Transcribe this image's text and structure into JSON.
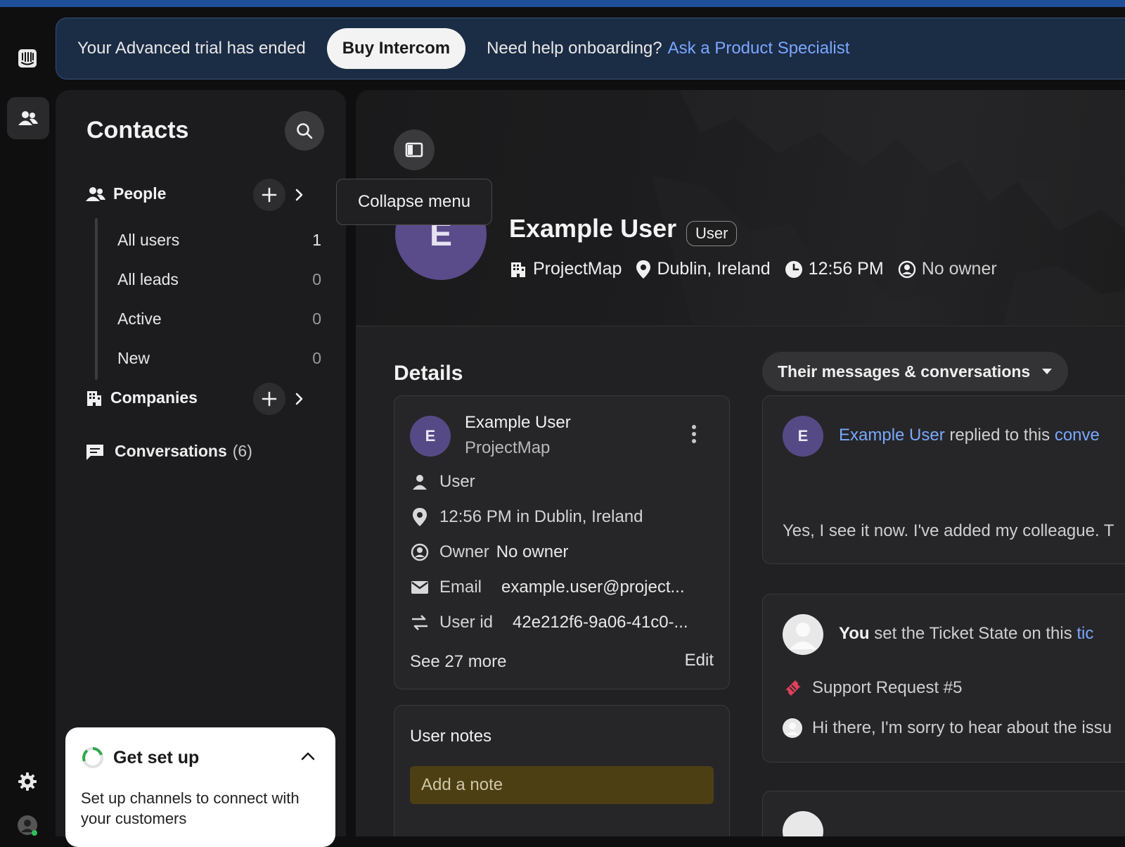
{
  "banner": {
    "trial_text": "Your Advanced trial has ended",
    "buy_label": "Buy Intercom",
    "help_text": "Need help onboarding?",
    "help_link": "Ask a Product Specialist"
  },
  "sidebar": {
    "title": "Contacts",
    "people_label": "People",
    "people_items": [
      {
        "label": "All users",
        "count": "1"
      },
      {
        "label": "All leads",
        "count": "0"
      },
      {
        "label": "Active",
        "count": "0"
      },
      {
        "label": "New",
        "count": "0"
      }
    ],
    "companies_label": "Companies",
    "conversations_label": "Conversations",
    "conversations_count": "(6)"
  },
  "setup": {
    "title": "Get set up",
    "description": "Set up channels to connect with your customers"
  },
  "tooltip": "Collapse menu",
  "profile": {
    "avatar_letter": "E",
    "name": "Example User",
    "badge": "User",
    "company": "ProjectMap",
    "location": "Dublin, Ireland",
    "time": "12:56 PM",
    "owner": "No owner"
  },
  "details": {
    "title": "Details",
    "card": {
      "avatar_letter": "E",
      "name": "Example User",
      "company": "ProjectMap",
      "type": "User",
      "local_time": "12:56 PM in Dublin, Ireland",
      "owner_label": "Owner",
      "owner_value": "No owner",
      "email_label": "Email",
      "email_value": "example.user@project...",
      "userid_label": "User id",
      "userid_value": "42e212f6-9a06-41c0-...",
      "see_more": "See 27 more",
      "edit": "Edit"
    },
    "notes_title": "User notes",
    "notes_placeholder": "Add a note"
  },
  "feed": {
    "filter_label": "Their messages & conversations",
    "item1": {
      "avatar_letter": "E",
      "actor": "Example User",
      "action": "replied to this",
      "link": "conve",
      "snippet": "Yes, I see it now. I've added my colleague. T"
    },
    "item2": {
      "actor": "You",
      "action": "set the Ticket State on this",
      "link": "tic",
      "ticket": "Support Request #5",
      "snippet": "Hi there, I'm sorry to hear about the issu"
    }
  },
  "colors": {
    "banner_bg": "#1b2c45",
    "link": "#7aa7ff",
    "avatar_purple": "#5a4c8a",
    "note_bg": "#4b3f13",
    "ticket_red": "#e0405a"
  }
}
